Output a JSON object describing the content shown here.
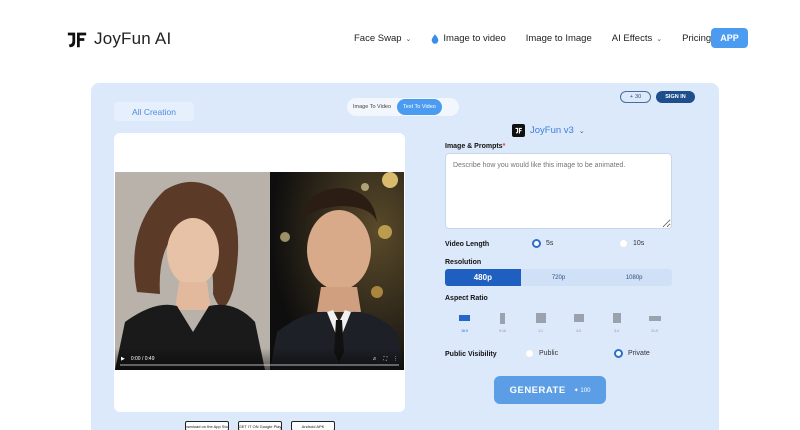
{
  "brand": {
    "name": "JoyFun AI"
  },
  "nav": {
    "items": [
      {
        "label": "Face Swap",
        "has_dropdown": true
      },
      {
        "label": "Image to video",
        "icon": "water-drop-icon"
      },
      {
        "label": "Image to Image"
      },
      {
        "label": "AI Effects",
        "has_dropdown": true
      },
      {
        "label": "Pricing"
      }
    ],
    "app_button": "APP"
  },
  "panel": {
    "all_creation": "All Creation",
    "mode_tabs": [
      {
        "label": "Image To Video",
        "active": false
      },
      {
        "label": "Text To Video",
        "active": true
      }
    ],
    "credits": "30",
    "sign_in": "SIGN IN"
  },
  "video": {
    "time": "0:00 / 0:49",
    "store_badges": [
      "Download on the App Store",
      "GET IT ON Google Play",
      "Android APK"
    ]
  },
  "form": {
    "model": "JoyFun v3",
    "prompt_label": "Image & Prompts",
    "prompt_placeholder": "Describe how you would like this image to be animated.",
    "length_label": "Video Length",
    "length_options": [
      {
        "label": "5s",
        "selected": true
      },
      {
        "label": "10s",
        "selected": false
      }
    ],
    "resolution_label": "Resolution",
    "resolution_options": [
      {
        "label": "480p",
        "selected": true
      },
      {
        "label": "720p",
        "selected": false
      },
      {
        "label": "1080p",
        "selected": false
      }
    ],
    "aspect_label": "Aspect Ratio",
    "aspect_options": [
      {
        "label": "16:9",
        "selected": true
      },
      {
        "label": "9:16",
        "selected": false
      },
      {
        "label": "1:1",
        "selected": false
      },
      {
        "label": "4:3",
        "selected": false
      },
      {
        "label": "3:4",
        "selected": false
      },
      {
        "label": "21:9",
        "selected": false
      }
    ],
    "visibility_label": "Public Visibility",
    "visibility_options": [
      {
        "label": "Public",
        "selected": false
      },
      {
        "label": "Private",
        "selected": true
      }
    ],
    "generate_label": "GENERATE",
    "generate_cost": "100"
  },
  "colors": {
    "accent": "#4b9cf1",
    "panel": "#dce9fb",
    "selected": "#1f5fbf"
  }
}
